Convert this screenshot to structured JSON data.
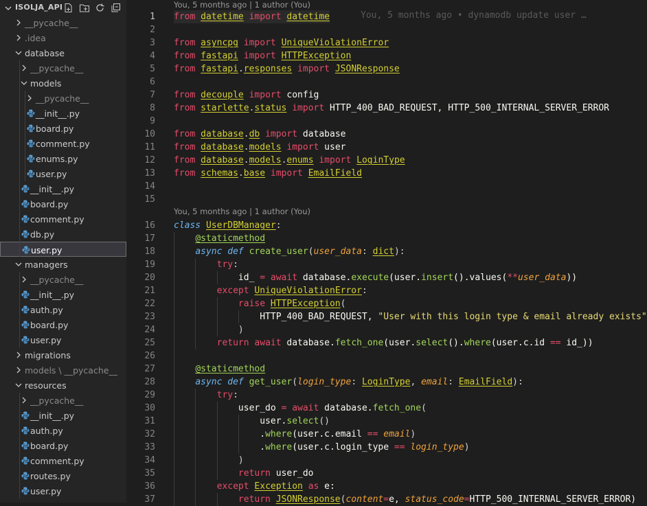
{
  "explorer": {
    "title": "ISOLJA_API",
    "actions": [
      "new-file-icon",
      "new-folder-icon",
      "refresh-icon",
      "collapse-all-icon"
    ],
    "tree": [
      {
        "label": "__pycache__",
        "depth": 1,
        "kind": "folder",
        "open": false,
        "dim": true
      },
      {
        "label": ".idea",
        "depth": 1,
        "kind": "folder",
        "open": false,
        "dim": true
      },
      {
        "label": "database",
        "depth": 1,
        "kind": "folder",
        "open": true
      },
      {
        "label": "__pycache__",
        "depth": 2,
        "kind": "folder",
        "open": false,
        "dim": true
      },
      {
        "label": "models",
        "depth": 2,
        "kind": "folder",
        "open": true
      },
      {
        "label": "__pycache__",
        "depth": 3,
        "kind": "folder",
        "open": false,
        "dim": true
      },
      {
        "label": "__init__.py",
        "depth": 3,
        "kind": "py"
      },
      {
        "label": "board.py",
        "depth": 3,
        "kind": "py"
      },
      {
        "label": "comment.py",
        "depth": 3,
        "kind": "py"
      },
      {
        "label": "enums.py",
        "depth": 3,
        "kind": "py"
      },
      {
        "label": "user.py",
        "depth": 3,
        "kind": "py"
      },
      {
        "label": "__init__.py",
        "depth": 2,
        "kind": "py"
      },
      {
        "label": "board.py",
        "depth": 2,
        "kind": "py"
      },
      {
        "label": "comment.py",
        "depth": 2,
        "kind": "py"
      },
      {
        "label": "db.py",
        "depth": 2,
        "kind": "py"
      },
      {
        "label": "user.py",
        "depth": 2,
        "kind": "py",
        "selected": true
      },
      {
        "label": "managers",
        "depth": 1,
        "kind": "folder",
        "open": true
      },
      {
        "label": "__pycache__",
        "depth": 2,
        "kind": "folder",
        "open": false,
        "dim": true
      },
      {
        "label": "__init__.py",
        "depth": 2,
        "kind": "py"
      },
      {
        "label": "auth.py",
        "depth": 2,
        "kind": "py"
      },
      {
        "label": "board.py",
        "depth": 2,
        "kind": "py"
      },
      {
        "label": "user.py",
        "depth": 2,
        "kind": "py"
      },
      {
        "label": "migrations",
        "depth": 1,
        "kind": "folder",
        "open": false
      },
      {
        "label": "models",
        "depth": 1,
        "kind": "folder",
        "open": false,
        "dim": true,
        "suffix": " \\ __pycache__"
      },
      {
        "label": "resources",
        "depth": 1,
        "kind": "folder",
        "open": true
      },
      {
        "label": "__pycache__",
        "depth": 2,
        "kind": "folder",
        "open": false,
        "dim": true
      },
      {
        "label": "__init__.py",
        "depth": 2,
        "kind": "py"
      },
      {
        "label": "auth.py",
        "depth": 2,
        "kind": "py"
      },
      {
        "label": "board.py",
        "depth": 2,
        "kind": "py"
      },
      {
        "label": "comment.py",
        "depth": 2,
        "kind": "py"
      },
      {
        "label": "routes.py",
        "depth": 2,
        "kind": "py"
      },
      {
        "label": "user.py",
        "depth": 2,
        "kind": "py"
      }
    ]
  },
  "editor": {
    "codelens_top": "You, 5 months ago | 1 author (You)",
    "codelens_class": "You, 5 months ago | 1 author (You)",
    "blame_line1": "You, 5 months ago • dynamodb update user …",
    "active_line": 1,
    "lines": [
      {
        "n": 1,
        "t": [
          [
            "from",
            "kw"
          ],
          [
            " ",
            ""
          ],
          [
            "datetime",
            "mod"
          ],
          [
            " ",
            ""
          ],
          [
            "import",
            "kw"
          ],
          [
            " ",
            ""
          ],
          [
            "datetime",
            "mod"
          ]
        ]
      },
      {
        "n": 2,
        "t": []
      },
      {
        "n": 3,
        "t": [
          [
            "from",
            "kw"
          ],
          [
            " ",
            ""
          ],
          [
            "asyncpg",
            "mod"
          ],
          [
            " ",
            ""
          ],
          [
            "import",
            "kw"
          ],
          [
            " ",
            ""
          ],
          [
            "UniqueViolationError",
            "cls"
          ]
        ]
      },
      {
        "n": 4,
        "t": [
          [
            "from",
            "kw"
          ],
          [
            " ",
            ""
          ],
          [
            "fastapi",
            "mod"
          ],
          [
            " ",
            ""
          ],
          [
            "import",
            "kw"
          ],
          [
            " ",
            ""
          ],
          [
            "HTTPException",
            "cls"
          ]
        ]
      },
      {
        "n": 5,
        "t": [
          [
            "from",
            "kw"
          ],
          [
            " ",
            ""
          ],
          [
            "fastapi",
            "mod"
          ],
          [
            ".",
            ""
          ],
          [
            "responses",
            "mod"
          ],
          [
            " ",
            ""
          ],
          [
            "import",
            "kw"
          ],
          [
            " ",
            ""
          ],
          [
            "JSONResponse",
            "cls"
          ]
        ]
      },
      {
        "n": 6,
        "t": []
      },
      {
        "n": 7,
        "t": [
          [
            "from",
            "kw"
          ],
          [
            " ",
            ""
          ],
          [
            "decouple",
            "mod"
          ],
          [
            " ",
            ""
          ],
          [
            "import",
            "kw"
          ],
          [
            " config",
            "plain"
          ]
        ]
      },
      {
        "n": 8,
        "t": [
          [
            "from",
            "kw"
          ],
          [
            " ",
            ""
          ],
          [
            "starlette",
            "mod"
          ],
          [
            ".",
            ""
          ],
          [
            "status",
            "mod"
          ],
          [
            " ",
            ""
          ],
          [
            "import",
            "kw"
          ],
          [
            " HTTP_400_BAD_REQUEST, HTTP_500_INTERNAL_SERVER_ERROR",
            "plain"
          ]
        ]
      },
      {
        "n": 9,
        "t": []
      },
      {
        "n": 10,
        "t": [
          [
            "from",
            "kw"
          ],
          [
            " ",
            ""
          ],
          [
            "database",
            "mod"
          ],
          [
            ".",
            ""
          ],
          [
            "db",
            "mod"
          ],
          [
            " ",
            ""
          ],
          [
            "import",
            "kw"
          ],
          [
            " database",
            "plain"
          ]
        ]
      },
      {
        "n": 11,
        "t": [
          [
            "from",
            "kw"
          ],
          [
            " ",
            ""
          ],
          [
            "database",
            "mod"
          ],
          [
            ".",
            ""
          ],
          [
            "models",
            "mod"
          ],
          [
            " ",
            ""
          ],
          [
            "import",
            "kw"
          ],
          [
            " user",
            "plain"
          ]
        ]
      },
      {
        "n": 12,
        "t": [
          [
            "from",
            "kw"
          ],
          [
            " ",
            ""
          ],
          [
            "database",
            "mod"
          ],
          [
            ".",
            ""
          ],
          [
            "models",
            "mod"
          ],
          [
            ".",
            ""
          ],
          [
            "enums",
            "mod"
          ],
          [
            " ",
            ""
          ],
          [
            "import",
            "kw"
          ],
          [
            " ",
            ""
          ],
          [
            "LoginType",
            "cls"
          ]
        ]
      },
      {
        "n": 13,
        "t": [
          [
            "from",
            "kw"
          ],
          [
            " ",
            ""
          ],
          [
            "schemas",
            "mod"
          ],
          [
            ".",
            ""
          ],
          [
            "base",
            "mod"
          ],
          [
            " ",
            ""
          ],
          [
            "import",
            "kw"
          ],
          [
            " ",
            ""
          ],
          [
            "EmailField",
            "cls"
          ]
        ]
      },
      {
        "n": 14,
        "t": []
      },
      {
        "n": 15,
        "t": []
      },
      {
        "n": 16,
        "t": [
          [
            "class",
            "stkw"
          ],
          [
            " ",
            ""
          ],
          [
            "UserDBManager",
            "cls"
          ],
          [
            ":",
            ""
          ]
        ]
      },
      {
        "n": 17,
        "t": [
          [
            "    ",
            ""
          ],
          [
            "@staticmethod",
            "dec"
          ]
        ]
      },
      {
        "n": 18,
        "t": [
          [
            "    ",
            ""
          ],
          [
            "async",
            "stkw"
          ],
          [
            " ",
            ""
          ],
          [
            "def",
            "stkw"
          ],
          [
            " ",
            ""
          ],
          [
            "create_user",
            "fn"
          ],
          [
            "(",
            ""
          ],
          [
            "user_data",
            "param"
          ],
          [
            ": ",
            ""
          ],
          [
            "dict",
            "cls"
          ],
          [
            "):",
            ""
          ]
        ]
      },
      {
        "n": 19,
        "t": [
          [
            "        ",
            ""
          ],
          [
            "try",
            "kw"
          ],
          [
            ":",
            ""
          ]
        ]
      },
      {
        "n": 20,
        "t": [
          [
            "            id_ ",
            "plain"
          ],
          [
            "=",
            "op"
          ],
          [
            " ",
            ""
          ],
          [
            "await",
            "kw"
          ],
          [
            " database.",
            "plain"
          ],
          [
            "execute",
            "fn"
          ],
          [
            "(user.",
            "plain"
          ],
          [
            "insert",
            "fn"
          ],
          [
            "().",
            "plain"
          ],
          [
            "values",
            "plain"
          ],
          [
            "(",
            "plain"
          ],
          [
            "**",
            "op"
          ],
          [
            "user_data",
            "param"
          ],
          [
            "))",
            "plain"
          ]
        ]
      },
      {
        "n": 21,
        "t": [
          [
            "        ",
            ""
          ],
          [
            "except",
            "kw"
          ],
          [
            " ",
            ""
          ],
          [
            "UniqueViolationError",
            "cls"
          ],
          [
            ":",
            ""
          ]
        ]
      },
      {
        "n": 22,
        "t": [
          [
            "            ",
            ""
          ],
          [
            "raise",
            "kw"
          ],
          [
            " ",
            ""
          ],
          [
            "HTTPException",
            "cls"
          ],
          [
            "(",
            ""
          ]
        ]
      },
      {
        "n": 23,
        "t": [
          [
            "                HTTP_400_BAD_REQUEST, ",
            "plain"
          ],
          [
            "\"User with this login type & email already exists\"",
            "str"
          ]
        ]
      },
      {
        "n": 24,
        "t": [
          [
            "            )",
            ""
          ]
        ]
      },
      {
        "n": 25,
        "t": [
          [
            "        ",
            ""
          ],
          [
            "return",
            "kw"
          ],
          [
            " ",
            ""
          ],
          [
            "await",
            "kw"
          ],
          [
            " database.",
            "plain"
          ],
          [
            "fetch_one",
            "fn"
          ],
          [
            "(user.",
            "plain"
          ],
          [
            "select",
            "fn"
          ],
          [
            "().",
            "plain"
          ],
          [
            "where",
            "fn"
          ],
          [
            "(user.c.id ",
            "plain"
          ],
          [
            "==",
            "op"
          ],
          [
            " id_))",
            "plain"
          ]
        ]
      },
      {
        "n": 26,
        "t": []
      },
      {
        "n": 27,
        "t": [
          [
            "    ",
            ""
          ],
          [
            "@staticmethod",
            "dec"
          ]
        ]
      },
      {
        "n": 28,
        "t": [
          [
            "    ",
            ""
          ],
          [
            "async",
            "stkw"
          ],
          [
            " ",
            ""
          ],
          [
            "def",
            "stkw"
          ],
          [
            " ",
            ""
          ],
          [
            "get_user",
            "fn"
          ],
          [
            "(",
            ""
          ],
          [
            "login_type",
            "param"
          ],
          [
            ": ",
            ""
          ],
          [
            "LoginType",
            "cls"
          ],
          [
            ", ",
            ""
          ],
          [
            "email",
            "param"
          ],
          [
            ": ",
            ""
          ],
          [
            "EmailField",
            "cls"
          ],
          [
            "):",
            ""
          ]
        ]
      },
      {
        "n": 29,
        "t": [
          [
            "        ",
            ""
          ],
          [
            "try",
            "kw"
          ],
          [
            ":",
            ""
          ]
        ]
      },
      {
        "n": 30,
        "t": [
          [
            "            user_do ",
            "plain"
          ],
          [
            "=",
            "op"
          ],
          [
            " ",
            ""
          ],
          [
            "await",
            "kw"
          ],
          [
            " database.",
            "plain"
          ],
          [
            "fetch_one",
            "fn"
          ],
          [
            "(",
            ""
          ]
        ]
      },
      {
        "n": 31,
        "t": [
          [
            "                user.",
            "plain"
          ],
          [
            "select",
            "fn"
          ],
          [
            "()",
            ""
          ]
        ]
      },
      {
        "n": 32,
        "t": [
          [
            "                .",
            "plain"
          ],
          [
            "where",
            "fn"
          ],
          [
            "(user.c.email ",
            "plain"
          ],
          [
            "==",
            "op"
          ],
          [
            " ",
            ""
          ],
          [
            "email",
            "param"
          ],
          [
            ")",
            ""
          ]
        ]
      },
      {
        "n": 33,
        "t": [
          [
            "                .",
            "plain"
          ],
          [
            "where",
            "fn"
          ],
          [
            "(user.c.login_type ",
            "plain"
          ],
          [
            "==",
            "op"
          ],
          [
            " ",
            ""
          ],
          [
            "login_type",
            "param"
          ],
          [
            ")",
            ""
          ]
        ]
      },
      {
        "n": 34,
        "t": [
          [
            "            )",
            ""
          ]
        ]
      },
      {
        "n": 35,
        "t": [
          [
            "            ",
            ""
          ],
          [
            "return",
            "kw"
          ],
          [
            " user_do",
            "plain"
          ]
        ]
      },
      {
        "n": 36,
        "t": [
          [
            "        ",
            ""
          ],
          [
            "except",
            "kw"
          ],
          [
            " ",
            ""
          ],
          [
            "Exception",
            "cls"
          ],
          [
            " ",
            ""
          ],
          [
            "as",
            "kw"
          ],
          [
            " e:",
            "plain"
          ]
        ]
      },
      {
        "n": 37,
        "t": [
          [
            "            ",
            ""
          ],
          [
            "return",
            "kw"
          ],
          [
            " ",
            ""
          ],
          [
            "JSONResponse",
            "cls"
          ],
          [
            "(",
            ""
          ],
          [
            "content",
            "param"
          ],
          [
            "=",
            "op"
          ],
          [
            "e, ",
            "plain"
          ],
          [
            "status_code",
            "param"
          ],
          [
            "=",
            "op"
          ],
          [
            "HTTP_500_INTERNAL_SERVER_ERROR)",
            "plain"
          ]
        ]
      }
    ]
  }
}
